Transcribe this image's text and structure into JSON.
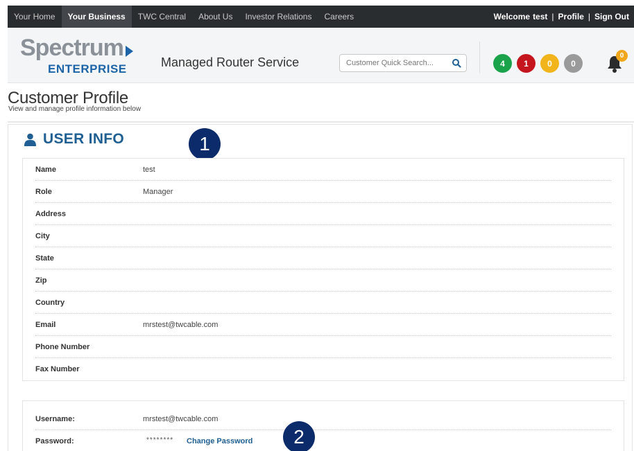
{
  "topnav": {
    "items": [
      {
        "label": "Your Home",
        "active": false
      },
      {
        "label": "Your Business",
        "active": true
      },
      {
        "label": "TWC Central",
        "active": false
      },
      {
        "label": "About Us",
        "active": false
      },
      {
        "label": "Investor Relations",
        "active": false
      },
      {
        "label": "Careers",
        "active": false
      }
    ],
    "welcome_label": "Welcome",
    "username": "test",
    "separator": "|",
    "profile_label": "Profile",
    "signout_label": "Sign Out"
  },
  "header": {
    "logo_word": "Spectrum",
    "logo_sub": "ENTERPRISE",
    "service_name": "Managed Router Service",
    "search_placeholder": "Customer Quick Search...",
    "search_icon": "search-icon",
    "badges": [
      {
        "count": "4",
        "color": "#1aa34a"
      },
      {
        "count": "1",
        "color": "#c4161c"
      },
      {
        "count": "0",
        "color": "#f2b41b"
      },
      {
        "count": "0",
        "color": "#9a9a9a"
      }
    ],
    "bell_icon": "bell-icon",
    "bell_count": "0"
  },
  "page": {
    "title": "Customer Profile",
    "subtitle": "View and manage profile information below"
  },
  "user_info": {
    "title": "USER INFO",
    "icon": "user-icon",
    "rows": [
      {
        "label": "Name",
        "value": "test"
      },
      {
        "label": "Role",
        "value": "Manager"
      },
      {
        "label": "Address",
        "value": ""
      },
      {
        "label": "City",
        "value": ""
      },
      {
        "label": "State",
        "value": ""
      },
      {
        "label": "Zip",
        "value": ""
      },
      {
        "label": "Country",
        "value": ""
      },
      {
        "label": "Email",
        "value": "mrstest@twcable.com"
      },
      {
        "label": "Phone Number",
        "value": ""
      },
      {
        "label": "Fax Number",
        "value": ""
      }
    ]
  },
  "credentials": {
    "username_label": "Username:",
    "username_value": "mrstest@twcable.com",
    "password_label": "Password:",
    "password_mask": "********",
    "change_password_label": "Change Password"
  },
  "callouts": {
    "one": "1",
    "two": "2"
  },
  "colors": {
    "nav_bg": "#2a2d30",
    "brand_blue": "#1f5f93",
    "callout_navy": "#0c2b6a"
  }
}
